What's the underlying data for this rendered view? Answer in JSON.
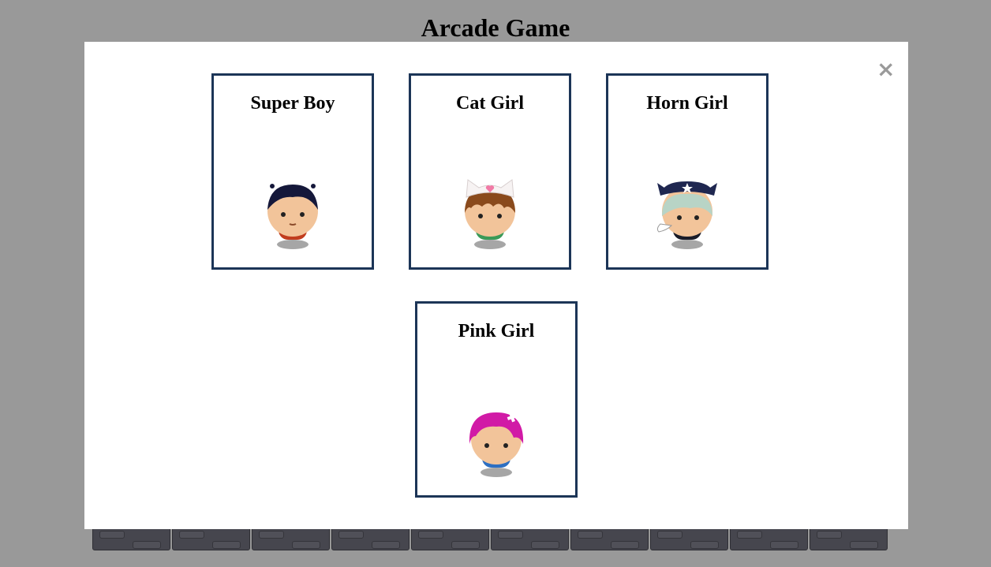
{
  "page": {
    "title": "Arcade Game"
  },
  "modal": {
    "close_label": "×",
    "characters": [
      {
        "name": "Super Boy",
        "icon": "super-boy-avatar-icon",
        "hair_color": "#15183a",
        "body_color": "#c13d1e"
      },
      {
        "name": "Cat Girl",
        "icon": "cat-girl-avatar-icon",
        "hair_color": "#8a4a1c",
        "body_color": "#3a9a58"
      },
      {
        "name": "Horn Girl",
        "icon": "horn-girl-avatar-icon",
        "hair_color": "#b8d4c6",
        "body_color": "#1a1c28"
      },
      {
        "name": "Pink Girl",
        "icon": "pink-girl-avatar-icon",
        "hair_color": "#d11aa6",
        "body_color": "#2d6fc2"
      }
    ]
  },
  "colors": {
    "overlay": "#999999",
    "card_border": "#1c3557",
    "close": "#9a9a9a"
  }
}
